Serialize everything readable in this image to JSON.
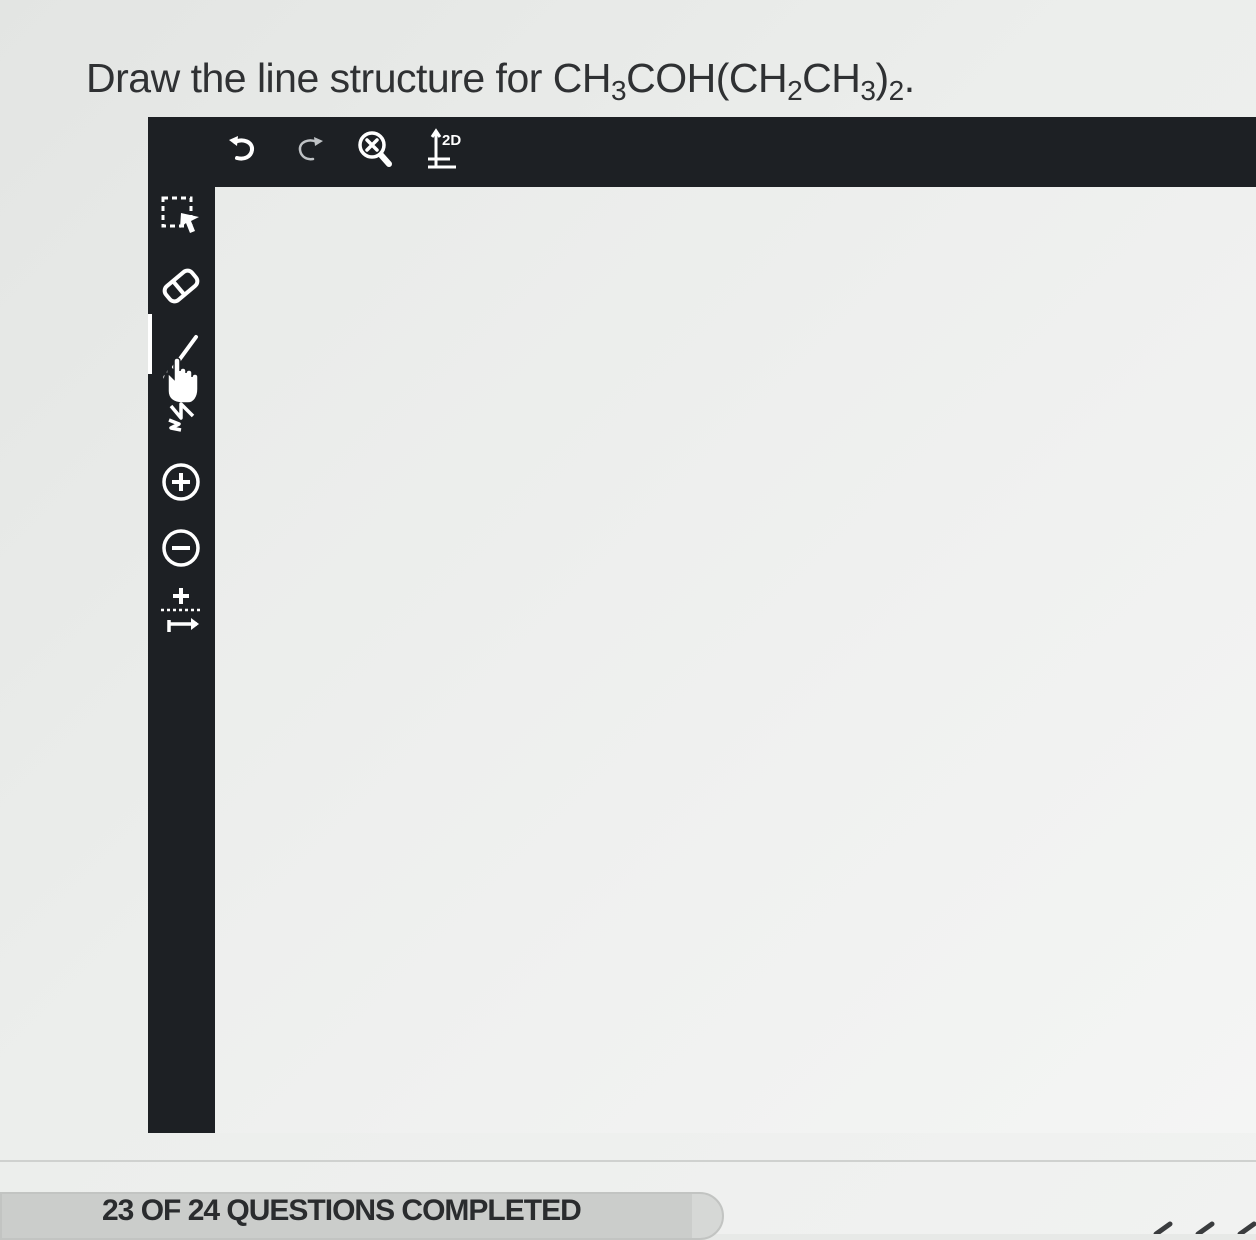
{
  "question": {
    "prefix": "Draw the line structure for CH",
    "sub1": "3",
    "mid1": "COH(CH",
    "sub2": "2",
    "mid2": "CH",
    "sub3": "3",
    "mid3": ")",
    "sub4": "2",
    "suffix": "."
  },
  "toolbar": {
    "top": [
      {
        "name": "new-document-icon"
      },
      {
        "name": "undo-icon"
      },
      {
        "name": "redo-icon"
      },
      {
        "name": "zoom-clear-icon"
      },
      {
        "name": "2d-template-icon",
        "label": "2D"
      }
    ],
    "left": [
      {
        "name": "selection-tool-icon"
      },
      {
        "name": "eraser-icon"
      },
      {
        "name": "bond-tool-icon",
        "active": true
      },
      {
        "name": "chain-tool-icon"
      },
      {
        "name": "positive-charge-icon"
      },
      {
        "name": "negative-charge-icon"
      },
      {
        "name": "arrow-tool-icon"
      }
    ]
  },
  "progress": {
    "label": "23 OF 24 QUESTIONS COMPLETED",
    "completed": 23,
    "total": 24
  },
  "colors": {
    "toolbar": "#1d2024",
    "icon": "#ffffff",
    "text": "#2f3133"
  }
}
